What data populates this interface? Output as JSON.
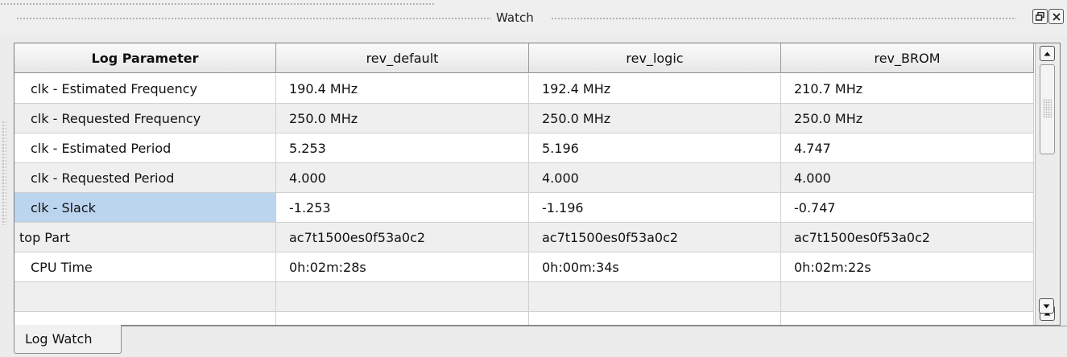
{
  "window": {
    "title": "Watch",
    "float_icon": "restore-window-icon",
    "close_icon": "close-icon"
  },
  "table": {
    "columns": [
      "Log Parameter",
      "rev_default",
      "rev_logic",
      "rev_BROM"
    ],
    "rows": [
      [
        "clk - Estimated Frequency",
        "190.4 MHz",
        "192.4 MHz",
        "210.7 MHz"
      ],
      [
        "clk - Requested Frequency",
        "250.0 MHz",
        "250.0 MHz",
        "250.0 MHz"
      ],
      [
        "clk - Estimated Period",
        "5.253",
        "5.196",
        "4.747"
      ],
      [
        "clk - Requested Period",
        "4.000",
        "4.000",
        "4.000"
      ],
      [
        "clk - Slack",
        "-1.253",
        "-1.196",
        "-0.747"
      ],
      [
        "top Part",
        "ac7t1500es0f53a0c2",
        "ac7t1500es0f53a0c2",
        "ac7t1500es0f53a0c2"
      ],
      [
        "CPU Time",
        "0h:02m:28s",
        "0h:00m:34s",
        "0h:02m:22s"
      ],
      [
        "",
        "",
        "",
        ""
      ],
      [
        "",
        "",
        "",
        ""
      ]
    ],
    "selected_row": 4
  },
  "tabs": [
    {
      "label": "Log Watch",
      "active": true
    }
  ],
  "colors": {
    "selection": "#bcd5ef",
    "alt_row": "#efefef",
    "background": "#ececec"
  }
}
